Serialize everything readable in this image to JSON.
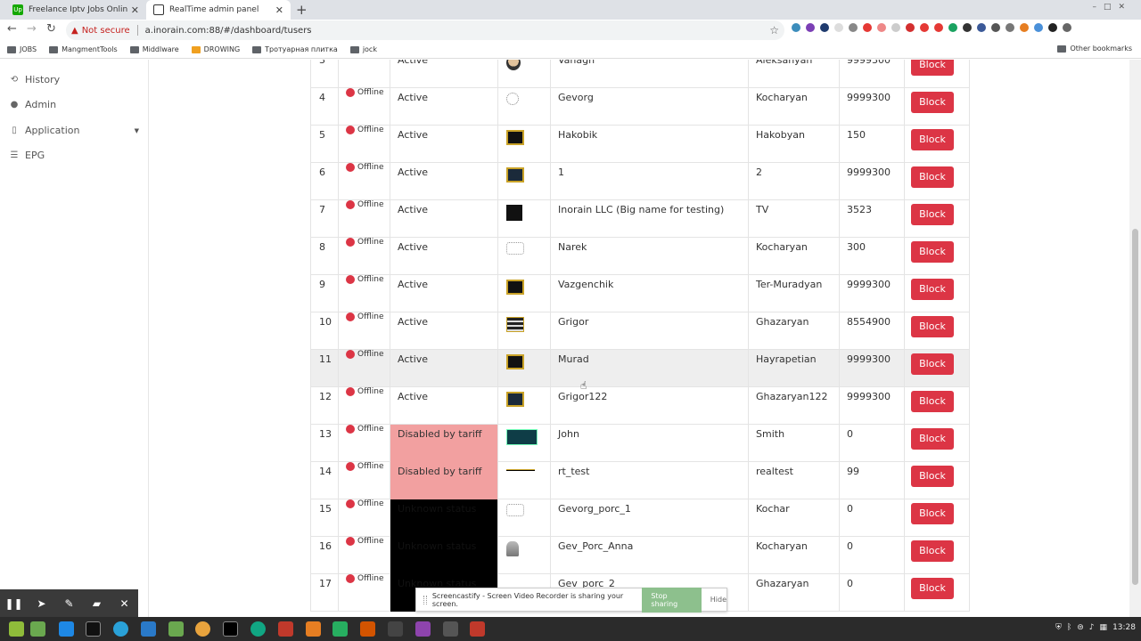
{
  "browser": {
    "tabs": [
      {
        "title": "Freelance Iptv Jobs Online - Up",
        "close": "✕",
        "fav_color": "#14a800",
        "fav_text": "Up"
      },
      {
        "title": "RealTime admin panel",
        "close": "✕",
        "fav_color": "#333333",
        "fav_text": ""
      }
    ],
    "new_tab": "+",
    "security_label": "Not secure",
    "url": "a.inorain.com:88/#/dashboard/tusers",
    "bookmarks": [
      "JOBS",
      "MangmentTools",
      "Middlware",
      "DROWING",
      "Тротуарная плитка",
      "jock"
    ],
    "other_bookmarks": "Other bookmarks"
  },
  "sidebar": {
    "items": [
      {
        "label": "History",
        "icon": "history-icon",
        "glyph": "⟲"
      },
      {
        "label": "Admin",
        "icon": "user-icon",
        "glyph": "👤"
      },
      {
        "label": "Application",
        "icon": "mobile-icon",
        "glyph": "▯"
      },
      {
        "label": "EPG",
        "icon": "list-icon",
        "glyph": "☰"
      }
    ]
  },
  "table": {
    "offline_label": "Offline",
    "block_label": "Block",
    "rows": [
      {
        "id": "3",
        "status": "Active",
        "status_type": "active",
        "thumb": "face",
        "first": "Vahagn",
        "last": "Aleksanyan",
        "balance": "9999300"
      },
      {
        "id": "4",
        "status": "Active",
        "status_type": "active",
        "thumb": "sketch",
        "first": "Gevorg",
        "last": "Kocharyan",
        "balance": "9999300"
      },
      {
        "id": "5",
        "status": "Active",
        "status_type": "active",
        "thumb": "dark",
        "first": "Hakobik",
        "last": "Hakobyan",
        "balance": "150"
      },
      {
        "id": "6",
        "status": "Active",
        "status_type": "active",
        "thumb": "blue",
        "first": "1",
        "last": "2",
        "balance": "9999300"
      },
      {
        "id": "7",
        "status": "Active",
        "status_type": "active",
        "thumb": "clef",
        "first": "Inorain LLC (Big name for testing)",
        "last": "TV",
        "balance": "3523"
      },
      {
        "id": "8",
        "status": "Active",
        "status_type": "active",
        "thumb": "sketch2",
        "first": "Narek",
        "last": "Kocharyan",
        "balance": "300"
      },
      {
        "id": "9",
        "status": "Active",
        "status_type": "active",
        "thumb": "dark",
        "first": "Vazgenchik",
        "last": "Ter-Muradyan",
        "balance": "9999300"
      },
      {
        "id": "10",
        "status": "Active",
        "status_type": "active",
        "thumb": "stripe",
        "first": "Grigor",
        "last": "Ghazaryan",
        "balance": "8554900"
      },
      {
        "id": "11",
        "status": "Active",
        "status_type": "active",
        "thumb": "dark",
        "first": "Murad",
        "last": "Hayrapetian",
        "balance": "9999300"
      },
      {
        "id": "12",
        "status": "Active",
        "status_type": "active",
        "thumb": "blue",
        "first": "Grigor122",
        "last": "Ghazaryan122",
        "balance": "9999300"
      },
      {
        "id": "13",
        "status": "Disabled by tariff",
        "status_type": "disabled",
        "thumb": "wide",
        "first": "John",
        "last": "Smith",
        "balance": "0"
      },
      {
        "id": "14",
        "status": "Disabled by tariff",
        "status_type": "disabled",
        "thumb": "line",
        "first": "rt_test",
        "last": "realtest",
        "balance": "99"
      },
      {
        "id": "15",
        "status": "Unknown status",
        "status_type": "unknown",
        "thumb": "sketch2",
        "first": "Gevorg_porc_1",
        "last": "Kochar",
        "balance": "0"
      },
      {
        "id": "16",
        "status": "Unknown status",
        "status_type": "unknown",
        "thumb": "person",
        "first": "Gev_Porc_Anna",
        "last": "Kocharyan",
        "balance": "0"
      },
      {
        "id": "17",
        "status": "Unknown status",
        "status_type": "unknown",
        "thumb": "none",
        "first": "Gev_porc_2",
        "last": "Ghazaryan",
        "balance": "0"
      }
    ]
  },
  "screencastify": {
    "message": "Screencastify - Screen Video Recorder is sharing your screen.",
    "stop_label": "Stop sharing",
    "hide_label": "Hide"
  },
  "taskbar": {
    "clock": "13:28"
  },
  "colors": {
    "danger": "#dc3545",
    "disabled_bg": "#f2a0a0",
    "unknown_bg": "#000000"
  }
}
